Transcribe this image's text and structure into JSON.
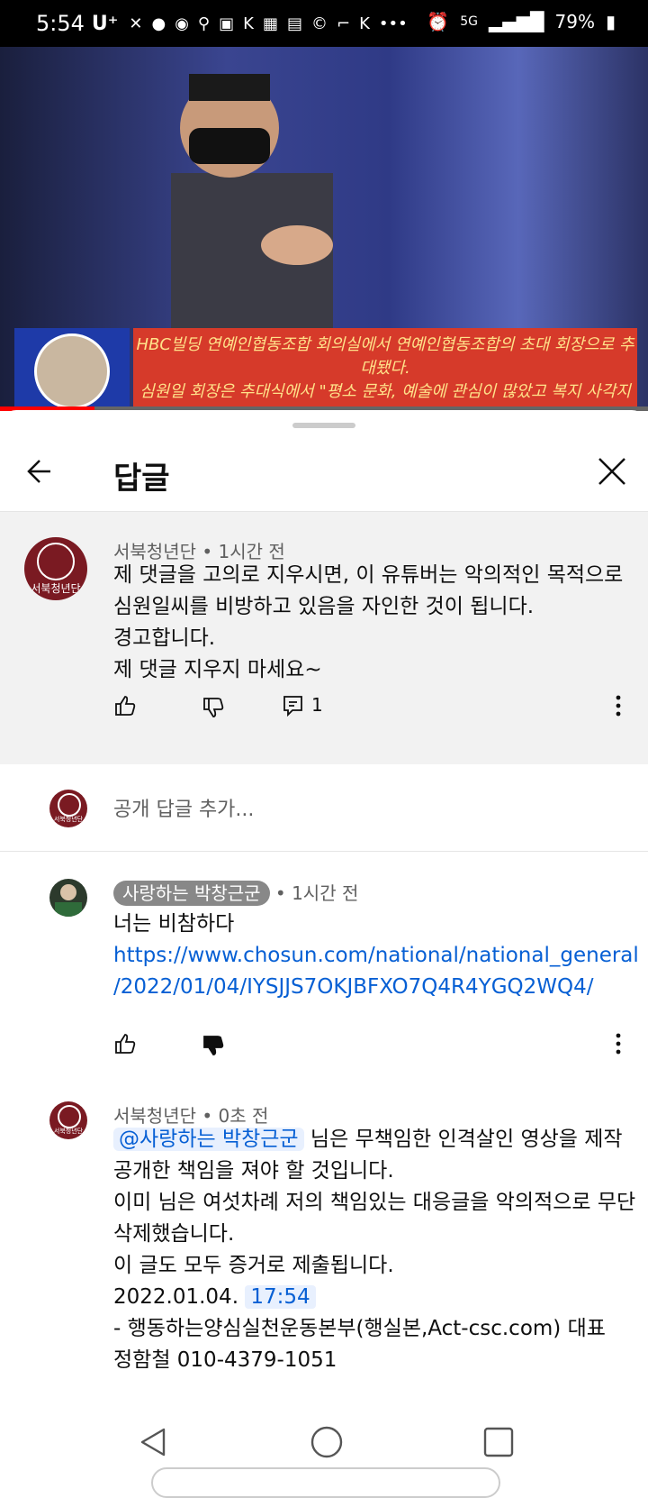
{
  "status_bar": {
    "time": "5:54",
    "carrier": "U⁺",
    "battery": "79%",
    "network": "5G"
  },
  "video": {
    "caption_line1": "HBC빌딩 연예인협동조합 회의실에서 연예인협동조합의 초대 회장으로 추",
    "caption_line2": "대됐다.",
    "caption_line3": "심원일 회장은 추대식에서 \"평소 문화, 예술에 관심이 많았고 복지 사각지"
  },
  "sheet": {
    "title": "답글"
  },
  "parent_comment": {
    "author": "서북청년단",
    "time": "• 1시간 전",
    "lines": [
      "제 댓글을 고의로 지우시면, 이 유튜버는 악의적인 목적으로",
      "심원일씨를 비방하고 있음을 자인한 것이 됩니다.",
      "경고합니다.",
      "제 댓글 지우지 마세요~"
    ],
    "reply_count": "1",
    "avatar_label": "서북청년단"
  },
  "add_reply": {
    "placeholder": "공개 답글 추가...",
    "avatar_label": "서북청년단"
  },
  "reply1": {
    "author": "사랑하는 박창근군",
    "time": "• 1시간 전",
    "line1": "너는 비참하다",
    "link_line1": "https://www.chosun.com/national/national_general",
    "link_line2": "/2022/01/04/IYSJJS7OKJBFXO7Q4R4YGQ2WQ4/"
  },
  "reply2": {
    "author": "서북청년단",
    "time": "• 0초 전",
    "mention": "@사랑하는 박창근군",
    "line1_rest": " 님은 무책임한 인격살인 영상을 제작",
    "lines": [
      "공개한 책임을 져야 할 것입니다.",
      "이미 님은 여섯차례 저의 책임있는 대응글을 악의적으로 무단",
      "삭제했습니다.",
      "이 글도 모두 증거로 제출됩니다."
    ],
    "date": "2022.01.04.",
    "time_link": "17:54",
    "sig1": "- 행동하는양심실천운동본부(행실본,Act-csc.com) 대표",
    "sig2": "정함철 010-4379-1051",
    "avatar_label": "서북청년단"
  },
  "colors": {
    "link": "#065fd4",
    "progress": "#ff0000",
    "avatar": "#7a1a22"
  }
}
